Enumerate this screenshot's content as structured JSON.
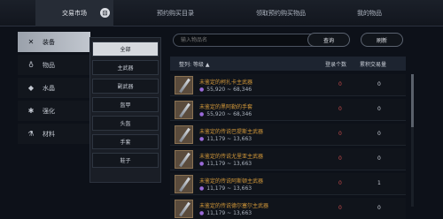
{
  "tabs": [
    {
      "label": "交易市场"
    },
    {
      "label": "预约购买目录"
    },
    {
      "label": "领取预约购买物品"
    },
    {
      "label": "我的物品"
    }
  ],
  "categories": [
    {
      "label": "装备",
      "icon": "crossed-swords-icon"
    },
    {
      "label": "物品",
      "icon": "potion-icon"
    },
    {
      "label": "水晶",
      "icon": "crystal-icon"
    },
    {
      "label": "强化",
      "icon": "gear-icon"
    },
    {
      "label": "材料",
      "icon": "flask-icon"
    }
  ],
  "subcategories": [
    "全部",
    "主武器",
    "副武器",
    "盔甲",
    "头盔",
    "手套",
    "鞋子"
  ],
  "search": {
    "placeholder": "输入物品名",
    "search_label": "查询",
    "refresh_label": "刷新"
  },
  "table": {
    "sort_label": "整列: 等级 ▲",
    "col_registered": "登录个数",
    "col_volume": "累积交易量"
  },
  "rows": [
    {
      "name": "未鉴定的柯扎卡主武器",
      "price": "55,920 ~ 68,346",
      "registered": "0",
      "volume": "0"
    },
    {
      "name": "未鉴定的黑阿勒的手套",
      "price": "55,920 ~ 68,346",
      "registered": "0",
      "volume": "0"
    },
    {
      "name": "未鉴定的传说巴提斯主武器",
      "price": "11,179 ~ 13,663",
      "registered": "0",
      "volume": "0"
    },
    {
      "name": "未鉴定的传说尤里亚主武器",
      "price": "11,179 ~ 13,663",
      "registered": "0",
      "volume": "0"
    },
    {
      "name": "未鉴定的传说阿斯顿主武器",
      "price": "11,179 ~ 13,663",
      "registered": "0",
      "volume": "1"
    },
    {
      "name": "未鉴定的传说德尔塞尔主武器",
      "price": "11,179 ~ 13,663",
      "registered": "0",
      "volume": "0"
    }
  ]
}
